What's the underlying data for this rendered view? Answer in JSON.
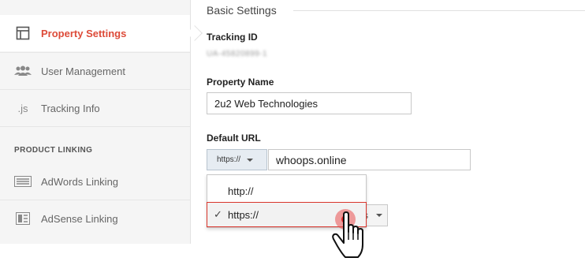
{
  "sidebar": {
    "items": [
      {
        "label": "Property Settings",
        "icon": "property-settings-icon",
        "active": true
      },
      {
        "label": "User Management",
        "icon": "users-icon",
        "active": false
      },
      {
        "label": "Tracking Info",
        "icon": "js-icon",
        "icon_text": ".js",
        "active": false
      }
    ],
    "section_heading": "PRODUCT LINKING",
    "linking_items": [
      {
        "label": "AdWords Linking",
        "icon": "adwords-icon"
      },
      {
        "label": "AdSense Linking",
        "icon": "adsense-icon"
      }
    ]
  },
  "main": {
    "section_title": "Basic Settings",
    "tracking_id": {
      "label": "Tracking ID",
      "value": "UA-45820899-1"
    },
    "property_name": {
      "label": "Property Name",
      "value": "2u2 Web Technologies"
    },
    "default_url": {
      "label": "Default URL",
      "protocol": "https://",
      "domain": "whoops.online",
      "options": [
        {
          "label": "http://",
          "selected": false
        },
        {
          "label": "https://",
          "selected": true
        }
      ]
    },
    "obscured_button_fragment": "s"
  },
  "colors": {
    "accent": "#dd4b39",
    "highlight_border": "#d9342b",
    "click_marker": "#e02b2b"
  }
}
